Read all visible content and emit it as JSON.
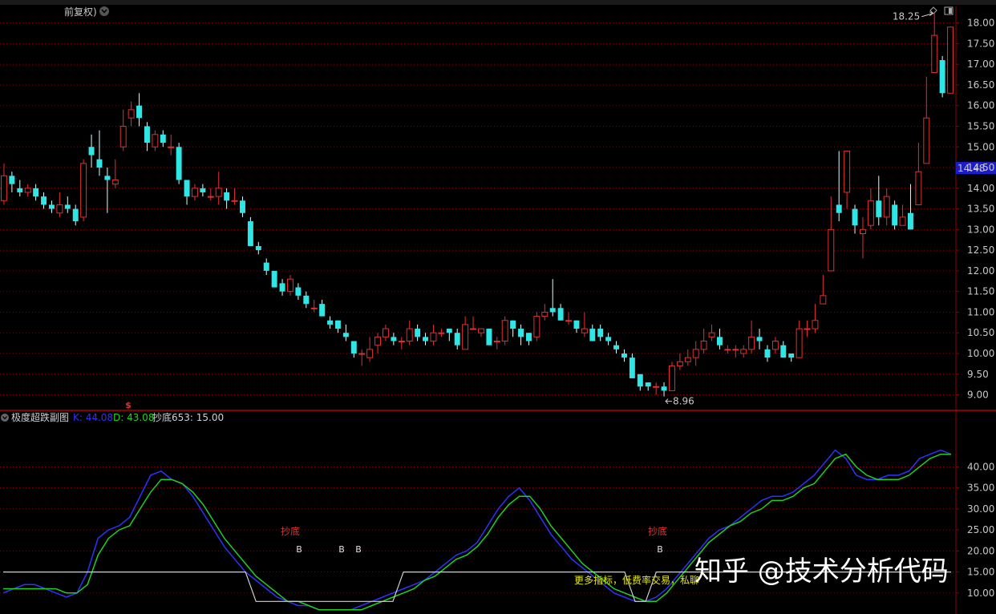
{
  "header": {
    "title": "前复权)"
  },
  "colors": {
    "up": "#e03030",
    "down": "#2ee6e6",
    "grid": "#8b0000",
    "axis": "#c8c8c8",
    "k": "#3030ff",
    "d": "#20d020",
    "chaodi": "#d0d0d0",
    "yellow": "#e8e800",
    "highlight": "#1c1ccf"
  },
  "price_panel": {
    "high_label": "18.25",
    "low_label": "8.96",
    "current_price": "14.48",
    "signal_marker": "$"
  },
  "indicator_panel": {
    "name": "极度超跌副图",
    "k_label": "K: 44.08",
    "d_label": "D: 43.08",
    "chaodi_label": "抄底653: 15.00",
    "signal_labels": [
      "抄底",
      "抄底"
    ],
    "b_markers": [
      "B",
      "B",
      "B",
      "B"
    ],
    "promo_text": "更多指标，低费率交易，私聊"
  },
  "watermark": "知乎 @技术分析代码",
  "chart_data": [
    {
      "type": "candlestick",
      "title": "",
      "ylim": [
        8.7,
        18.4
      ],
      "y_ticks": [
        "9.00",
        "9.50",
        "10.00",
        "10.50",
        "11.00",
        "11.50",
        "12.00",
        "12.50",
        "13.00",
        "13.50",
        "14.00",
        "14.50",
        "15.00",
        "15.50",
        "16.00",
        "16.50",
        "17.00",
        "17.50",
        "18.00"
      ],
      "annotations": {
        "high": 18.25,
        "low": 8.96,
        "current": 14.48
      },
      "candles": [
        [
          13.7,
          14.3,
          14.6,
          13.6
        ],
        [
          14.3,
          14.1,
          14.4,
          13.9
        ],
        [
          14.0,
          13.9,
          14.2,
          13.8
        ],
        [
          13.9,
          14.0,
          14.1,
          13.8
        ],
        [
          14.0,
          13.8,
          14.1,
          13.7
        ],
        [
          13.8,
          13.6,
          13.9,
          13.5
        ],
        [
          13.6,
          13.5,
          13.7,
          13.4
        ],
        [
          13.4,
          13.6,
          13.9,
          13.3
        ],
        [
          13.6,
          13.5,
          13.8,
          13.4
        ],
        [
          13.5,
          13.2,
          13.6,
          13.1
        ],
        [
          13.3,
          14.6,
          14.7,
          13.2
        ],
        [
          15.0,
          14.8,
          15.3,
          14.5
        ],
        [
          14.7,
          14.5,
          15.4,
          14.3
        ],
        [
          14.3,
          14.2,
          14.5,
          13.4
        ],
        [
          14.1,
          14.2,
          14.7,
          14.0
        ],
        [
          15.0,
          15.5,
          15.9,
          14.9
        ],
        [
          15.7,
          15.9,
          16.1,
          15.5
        ],
        [
          16.0,
          15.7,
          16.3,
          15.5
        ],
        [
          15.5,
          15.1,
          15.6,
          14.9
        ],
        [
          15.0,
          15.3,
          15.4,
          14.9
        ],
        [
          15.3,
          15.1,
          15.4,
          15.0
        ],
        [
          15.0,
          15.0,
          15.3,
          14.8
        ],
        [
          15.0,
          14.2,
          15.1,
          14.1
        ],
        [
          14.2,
          13.8,
          14.2,
          13.6
        ],
        [
          13.8,
          14.0,
          14.1,
          13.7
        ],
        [
          14.0,
          13.9,
          14.1,
          13.8
        ],
        [
          13.8,
          13.8,
          14.0,
          13.7
        ],
        [
          13.8,
          14.0,
          14.4,
          13.6
        ],
        [
          13.9,
          13.7,
          14.0,
          13.5
        ],
        [
          13.7,
          13.7,
          14.0,
          13.6
        ],
        [
          13.7,
          13.4,
          13.8,
          13.3
        ],
        [
          13.2,
          12.6,
          13.3,
          12.6
        ],
        [
          12.6,
          12.5,
          12.7,
          12.4
        ],
        [
          12.2,
          12.0,
          12.3,
          11.9
        ],
        [
          12.0,
          11.6,
          12.0,
          11.6
        ],
        [
          11.7,
          11.5,
          11.8,
          11.4
        ],
        [
          11.5,
          11.8,
          11.9,
          11.4
        ],
        [
          11.6,
          11.4,
          11.7,
          11.3
        ],
        [
          11.4,
          11.2,
          11.5,
          11.1
        ],
        [
          11.1,
          11.1,
          11.3,
          11.0
        ],
        [
          11.2,
          10.9,
          11.3,
          10.9
        ],
        [
          10.8,
          10.7,
          10.9,
          10.6
        ],
        [
          10.8,
          10.6,
          10.8,
          10.5
        ],
        [
          10.5,
          10.4,
          10.7,
          10.3
        ],
        [
          10.3,
          10.0,
          10.3,
          9.9
        ],
        [
          10.0,
          10.0,
          10.1,
          9.7
        ],
        [
          9.9,
          10.1,
          10.4,
          9.8
        ],
        [
          10.2,
          10.4,
          10.5,
          10.0
        ],
        [
          10.4,
          10.6,
          10.7,
          10.3
        ],
        [
          10.4,
          10.3,
          10.5,
          10.2
        ],
        [
          10.3,
          10.3,
          10.4,
          10.1
        ],
        [
          10.3,
          10.6,
          10.8,
          10.2
        ],
        [
          10.6,
          10.4,
          10.7,
          10.3
        ],
        [
          10.4,
          10.3,
          10.5,
          10.2
        ],
        [
          10.3,
          10.5,
          10.7,
          10.2
        ],
        [
          10.5,
          10.5,
          10.6,
          10.4
        ],
        [
          10.6,
          10.5,
          10.6,
          10.3
        ],
        [
          10.5,
          10.2,
          10.6,
          10.1
        ],
        [
          10.1,
          10.7,
          10.9,
          10.1
        ],
        [
          10.6,
          10.6,
          10.9,
          10.6
        ],
        [
          10.5,
          10.6,
          10.6,
          10.4
        ],
        [
          10.6,
          10.2,
          10.6,
          10.2
        ],
        [
          10.3,
          10.3,
          10.4,
          10.1
        ],
        [
          10.3,
          10.8,
          10.9,
          10.2
        ],
        [
          10.8,
          10.6,
          10.8,
          10.4
        ],
        [
          10.6,
          10.4,
          10.7,
          10.2
        ],
        [
          10.5,
          10.3,
          10.5,
          10.2
        ],
        [
          10.4,
          10.9,
          11.0,
          10.3
        ],
        [
          10.9,
          11.0,
          11.2,
          10.8
        ],
        [
          11.1,
          11.0,
          11.8,
          10.9
        ],
        [
          11.1,
          10.8,
          11.2,
          10.8
        ],
        [
          10.8,
          10.8,
          11.0,
          10.7
        ],
        [
          10.8,
          10.6,
          10.8,
          10.5
        ],
        [
          10.5,
          10.6,
          11.0,
          10.4
        ],
        [
          10.6,
          10.3,
          10.7,
          10.3
        ],
        [
          10.6,
          10.4,
          10.7,
          10.3
        ],
        [
          10.4,
          10.3,
          10.5,
          10.2
        ],
        [
          10.2,
          10.1,
          10.3,
          10.0
        ],
        [
          10.0,
          9.9,
          10.1,
          9.8
        ],
        [
          9.9,
          9.4,
          10.0,
          9.4
        ],
        [
          9.5,
          9.2,
          9.5,
          9.1
        ],
        [
          9.3,
          9.2,
          9.3,
          9.1
        ],
        [
          9.2,
          9.2,
          9.3,
          9.0
        ],
        [
          9.2,
          9.1,
          9.3,
          8.96
        ],
        [
          9.1,
          9.7,
          9.8,
          9.1
        ],
        [
          9.7,
          9.8,
          10.0,
          9.6
        ],
        [
          9.8,
          9.9,
          10.1,
          9.7
        ],
        [
          9.9,
          10.1,
          10.3,
          9.7
        ],
        [
          10.1,
          10.3,
          10.6,
          10.0
        ],
        [
          10.4,
          10.5,
          10.7,
          10.3
        ],
        [
          10.4,
          10.2,
          10.6,
          10.1
        ],
        [
          10.1,
          10.1,
          10.2,
          10.0
        ],
        [
          10.1,
          10.1,
          10.2,
          9.9
        ],
        [
          10.0,
          10.1,
          10.2,
          9.9
        ],
        [
          10.1,
          10.4,
          10.8,
          10.0
        ],
        [
          10.4,
          10.3,
          10.6,
          10.1
        ],
        [
          10.1,
          9.9,
          10.2,
          9.8
        ],
        [
          10.1,
          10.3,
          10.4,
          10.0
        ],
        [
          10.2,
          9.9,
          10.3,
          9.9
        ],
        [
          10.0,
          9.9,
          10.0,
          9.8
        ],
        [
          9.9,
          10.6,
          10.8,
          9.9
        ],
        [
          10.6,
          10.6,
          10.8,
          10.4
        ],
        [
          10.6,
          10.8,
          11.2,
          10.5
        ],
        [
          11.2,
          11.4,
          11.9,
          11.3
        ],
        [
          12.0,
          13.0,
          13.8,
          12.5
        ],
        [
          13.6,
          13.4,
          14.9,
          13.2
        ],
        [
          13.9,
          14.9,
          14.9,
          13.5
        ],
        [
          13.5,
          13.1,
          13.6,
          12.9
        ],
        [
          12.9,
          13.0,
          13.3,
          12.3
        ],
        [
          13.1,
          13.7,
          14.0,
          13.0
        ],
        [
          13.7,
          13.3,
          14.3,
          13.1
        ],
        [
          13.3,
          13.8,
          14.0,
          13.1
        ],
        [
          13.6,
          13.1,
          13.7,
          13.0
        ],
        [
          13.1,
          13.3,
          13.6,
          13.1
        ],
        [
          13.4,
          13.0,
          14.1,
          13.0
        ],
        [
          13.6,
          14.4,
          15.1,
          14.3
        ],
        [
          14.6,
          15.7,
          16.7,
          14.6
        ],
        [
          16.8,
          17.7,
          18.25,
          16.9
        ],
        [
          17.1,
          16.3,
          17.2,
          16.2
        ],
        [
          16.3,
          17.9,
          17.9,
          16.3
        ]
      ]
    },
    {
      "type": "line",
      "title": "",
      "ylim": [
        5,
        50
      ],
      "y_ticks": [
        "10.00",
        "15.00",
        "20.00",
        "25.00",
        "30.00",
        "35.00",
        "40.00"
      ],
      "series": [
        {
          "name": "K",
          "values": [
            10,
            11,
            12,
            12,
            11,
            10,
            9,
            10,
            15,
            23,
            25,
            26,
            28,
            33,
            38,
            39,
            37,
            36,
            33,
            29,
            25,
            21,
            18,
            15,
            13,
            11,
            9,
            8,
            7,
            7,
            6,
            6,
            6,
            6,
            7,
            8,
            9,
            10,
            11,
            12,
            13,
            15,
            17,
            19,
            20,
            22,
            26,
            30,
            33,
            35,
            32,
            28,
            24,
            21,
            18,
            16,
            14,
            12,
            10,
            9,
            8,
            8,
            9,
            11,
            14,
            17,
            20,
            23,
            25,
            26,
            28,
            30,
            32,
            33,
            33,
            34,
            36,
            38,
            41,
            44,
            42,
            38,
            37,
            37,
            38,
            38,
            39,
            42,
            43,
            44,
            43
          ]
        },
        {
          "name": "D",
          "values": [
            11,
            11,
            11,
            11,
            11,
            11,
            10,
            10,
            12,
            19,
            23,
            25,
            26,
            30,
            34,
            37,
            37,
            36,
            34,
            31,
            27,
            23,
            20,
            17,
            14,
            12,
            10,
            8,
            8,
            7,
            6,
            6,
            6,
            6,
            6,
            7,
            8,
            9,
            10,
            11,
            13,
            14,
            16,
            18,
            19,
            21,
            24,
            28,
            31,
            33,
            33,
            30,
            26,
            23,
            20,
            17,
            15,
            13,
            11,
            10,
            9,
            8,
            8,
            10,
            13,
            16,
            19,
            22,
            24,
            26,
            27,
            29,
            30,
            32,
            32,
            33,
            35,
            36,
            39,
            42,
            43,
            40,
            38,
            37,
            37,
            37,
            38,
            40,
            42,
            43,
            43
          ]
        },
        {
          "name": "抄底653",
          "values": [
            15,
            15,
            15,
            15,
            15,
            15,
            15,
            15,
            15,
            15,
            15,
            15,
            15,
            15,
            15,
            15,
            15,
            15,
            15,
            15,
            15,
            15,
            15,
            15,
            8,
            8,
            8,
            8,
            8,
            8,
            8,
            8,
            8,
            8,
            8,
            8,
            8,
            8,
            15,
            15,
            15,
            15,
            15,
            15,
            15,
            15,
            15,
            15,
            15,
            15,
            15,
            15,
            15,
            15,
            15,
            15,
            15,
            15,
            15,
            15,
            8,
            8,
            15,
            15,
            15,
            15,
            15,
            15,
            15,
            15,
            15,
            15,
            15,
            15,
            15,
            15,
            15,
            15,
            15,
            15,
            15,
            15,
            15,
            15,
            15,
            15,
            15,
            15,
            15,
            15,
            15
          ]
        }
      ]
    }
  ]
}
